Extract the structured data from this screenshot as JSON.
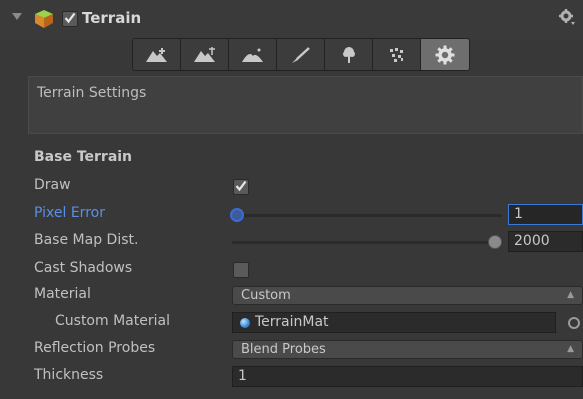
{
  "header": {
    "title": "Terrain",
    "enabled": true,
    "icons": {
      "foldout": "foldout-arrow-icon",
      "component": "terrain-cube-icon",
      "settings": "gear-icon"
    }
  },
  "toolbar": {
    "tools": [
      {
        "name": "raise-lower-terrain",
        "icon": "mountain-up-icon",
        "selected": false
      },
      {
        "name": "paint-height",
        "icon": "mountain-height-icon",
        "selected": false
      },
      {
        "name": "smooth-height",
        "icon": "mountain-smooth-icon",
        "selected": false
      },
      {
        "name": "paint-texture",
        "icon": "brush-icon",
        "selected": false
      },
      {
        "name": "place-trees",
        "icon": "tree-icon",
        "selected": false
      },
      {
        "name": "paint-details",
        "icon": "grass-icon",
        "selected": false
      },
      {
        "name": "terrain-settings",
        "icon": "gear-icon",
        "selected": true
      }
    ]
  },
  "help": {
    "text": "Terrain Settings"
  },
  "base_terrain": {
    "title": "Base Terrain",
    "draw": {
      "label": "Draw",
      "checked": true
    },
    "pixel_error": {
      "label": "Pixel Error",
      "value": "1",
      "slider_fraction": 0.0
    },
    "base_map_dist": {
      "label": "Base Map Dist.",
      "value": "2000",
      "slider_fraction": 1.0
    },
    "cast_shadows": {
      "label": "Cast Shadows",
      "checked": false
    },
    "material": {
      "label": "Material",
      "value": "Custom"
    },
    "custom_material": {
      "label": "Custom Material",
      "value": "TerrainMat"
    },
    "reflection_probes": {
      "label": "Reflection Probes",
      "value": "Blend Probes"
    },
    "thickness": {
      "label": "Thickness",
      "value": "1"
    }
  },
  "colors": {
    "background": "#383838",
    "active_label": "#5b8fe6",
    "focus_border": "#3a79d6"
  }
}
